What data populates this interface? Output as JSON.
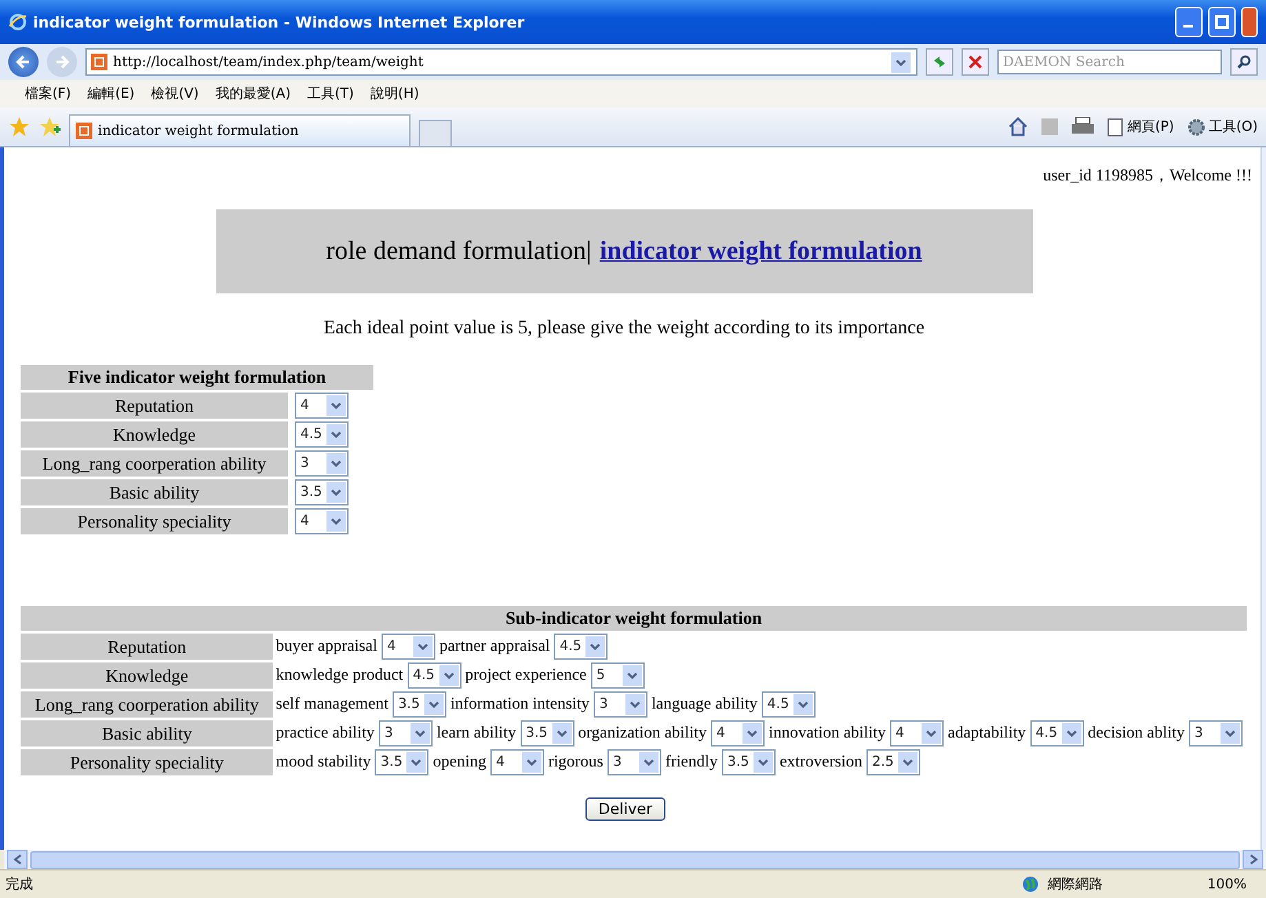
{
  "window": {
    "title": "indicator weight formulation - Windows Internet Explorer"
  },
  "address_bar": {
    "url": "http://localhost/team/index.php/team/weight"
  },
  "search": {
    "placeholder": "DAEMON Search"
  },
  "menu": [
    "檔案(F)",
    "編輯(E)",
    "檢視(V)",
    "我的最愛(A)",
    "工具(T)",
    "說明(H)"
  ],
  "tab": {
    "label": "indicator weight formulation"
  },
  "command_bar": [
    "網頁(P)",
    "工具(O)"
  ],
  "greeting": "user_id 1198985，Welcome !!!",
  "nav": {
    "text": "role demand formulation|",
    "link": "indicator weight formulation"
  },
  "instruction": "Each ideal point value is 5, please give the weight according to its importance",
  "five_table": {
    "title": "Five indicator weight formulation",
    "rows": [
      {
        "label": "Reputation",
        "value": "4"
      },
      {
        "label": "Knowledge",
        "value": "4.5"
      },
      {
        "label": "Long_rang coorperation ability",
        "value": "3"
      },
      {
        "label": "Basic ability",
        "value": "3.5"
      },
      {
        "label": "Personality speciality",
        "value": "4"
      }
    ]
  },
  "sub_table": {
    "title": "Sub-indicator weight formulation",
    "rows": [
      {
        "label": "Reputation",
        "items": [
          {
            "label": "buyer appraisal",
            "value": "4"
          },
          {
            "label": "partner appraisal",
            "value": "4.5"
          }
        ]
      },
      {
        "label": "Knowledge",
        "items": [
          {
            "label": "knowledge product",
            "value": "4.5"
          },
          {
            "label": "project experience",
            "value": "5"
          }
        ]
      },
      {
        "label": "Long_rang coorperation ability",
        "items": [
          {
            "label": "self management",
            "value": "3.5"
          },
          {
            "label": "information intensity",
            "value": "3"
          },
          {
            "label": "language ability",
            "value": "4.5"
          }
        ]
      },
      {
        "label": "Basic ability",
        "items": [
          {
            "label": "practice ability",
            "value": "3"
          },
          {
            "label": "learn ability",
            "value": "3.5"
          },
          {
            "label": "organization ability",
            "value": "4"
          },
          {
            "label": "innovation ability",
            "value": "4"
          },
          {
            "label": "adaptability",
            "value": "4.5"
          },
          {
            "label": "decision ablity",
            "value": "3"
          }
        ]
      },
      {
        "label": "Personality speciality",
        "items": [
          {
            "label": "mood stability",
            "value": "3.5"
          },
          {
            "label": "opening",
            "value": "4"
          },
          {
            "label": "rigorous",
            "value": "3"
          },
          {
            "label": "friendly",
            "value": "3.5"
          },
          {
            "label": "extroversion",
            "value": "2.5"
          }
        ]
      }
    ]
  },
  "submit": "Deliver",
  "status_bar": {
    "text": "完成",
    "zone": "網際網路",
    "zoom": "100%"
  }
}
